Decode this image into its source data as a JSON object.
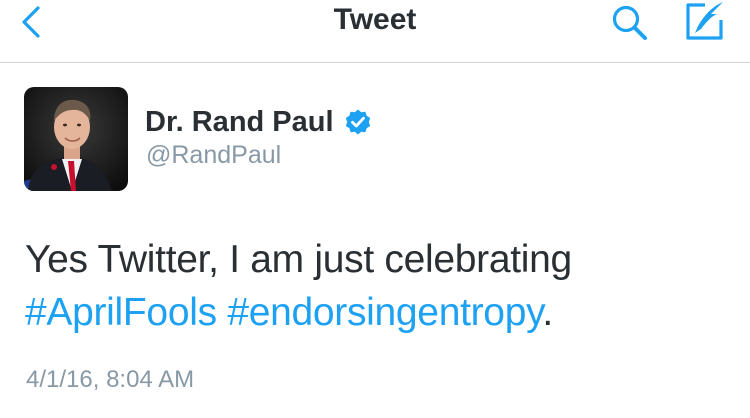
{
  "navbar": {
    "title": "Tweet",
    "back_icon": "chevron-left-icon",
    "search_icon": "search-icon",
    "compose_icon": "compose-tweet-icon",
    "accent_color": "#1da1f2"
  },
  "tweet": {
    "author": {
      "display_name": "Dr. Rand Paul",
      "handle": "@RandPaul",
      "verified": true,
      "verified_icon": "verified-badge-icon"
    },
    "text_parts": {
      "line1": "Yes Twitter, I am just celebrating",
      "hashtag1": "#AprilFools",
      "space": " ",
      "hashtag2": "#endorsingentropy",
      "end": "."
    },
    "timestamp": "4/1/16, 8:04 AM"
  }
}
